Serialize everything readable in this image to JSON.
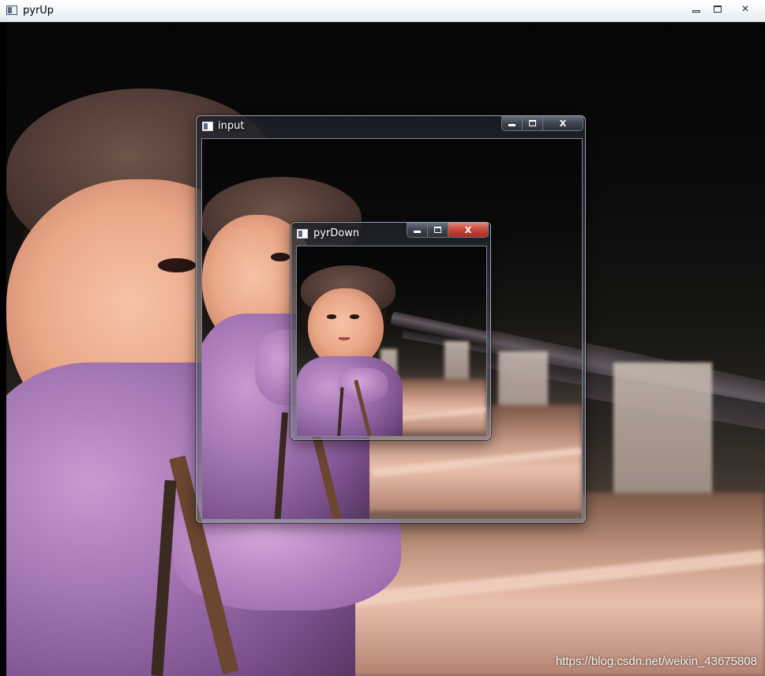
{
  "windows": {
    "pyrUp": {
      "title": "pyrUp",
      "minimize_label": "—",
      "maximize_label": "□",
      "close_label": "✕"
    },
    "input": {
      "title": "input",
      "minimize_label": "▬",
      "maximize_label": "□",
      "close_label": "X"
    },
    "pyrDown": {
      "title": "pyrDown",
      "minimize_label": "▬",
      "maximize_label": "□",
      "close_label": "X"
    }
  },
  "watermark": {
    "text": "https://blog.csdn.net/weixin_43675808"
  },
  "icons": {
    "app": "window-app-icon",
    "minimize": "minimize-icon",
    "maximize": "maximize-icon",
    "close": "close-icon"
  },
  "colors": {
    "close_active": "#c7463a",
    "glass_frame": "#3f4550",
    "titlebar_plain": "#f2f4f7"
  }
}
